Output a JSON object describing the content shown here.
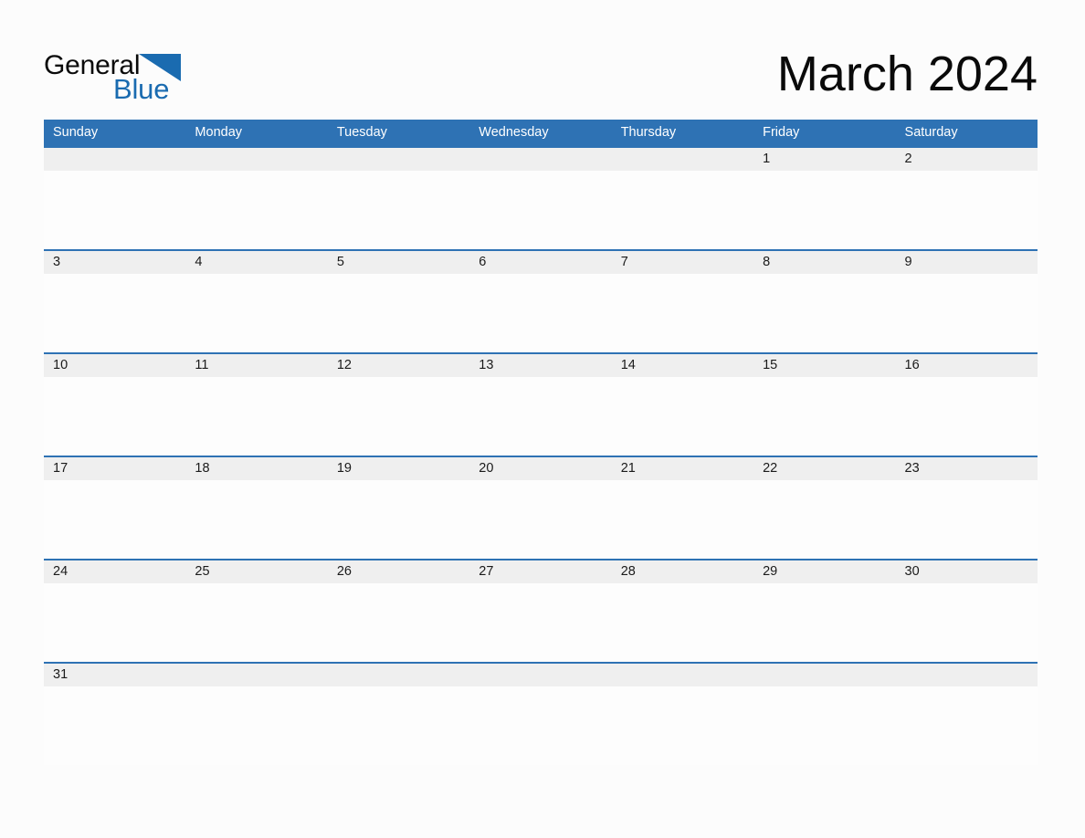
{
  "brand": {
    "word_primary": "General",
    "word_secondary": "Blue",
    "triangle_icon": "triangle-icon",
    "primary_color": "#0a0a0a",
    "secondary_color": "#1a6bb0"
  },
  "header": {
    "title": "March 2024",
    "month": "March",
    "year": "2024"
  },
  "theme": {
    "header_blue": "#2e72b4",
    "row_divider_blue": "#2e72b4",
    "date_band_gray": "#efefef",
    "page_background": "#fcfcfc",
    "cell_body_white": "#fdfdfd",
    "weekday_text": "#ffffff",
    "date_text": "#1a1a1a"
  },
  "calendar": {
    "weekdays": [
      "Sunday",
      "Monday",
      "Tuesday",
      "Wednesday",
      "Thursday",
      "Friday",
      "Saturday"
    ],
    "weeks": [
      [
        "",
        "",
        "",
        "",
        "",
        "1",
        "2"
      ],
      [
        "3",
        "4",
        "5",
        "6",
        "7",
        "8",
        "9"
      ],
      [
        "10",
        "11",
        "12",
        "13",
        "14",
        "15",
        "16"
      ],
      [
        "17",
        "18",
        "19",
        "20",
        "21",
        "22",
        "23"
      ],
      [
        "24",
        "25",
        "26",
        "27",
        "28",
        "29",
        "30"
      ],
      [
        "31",
        "",
        "",
        "",
        "",
        "",
        ""
      ]
    ]
  }
}
